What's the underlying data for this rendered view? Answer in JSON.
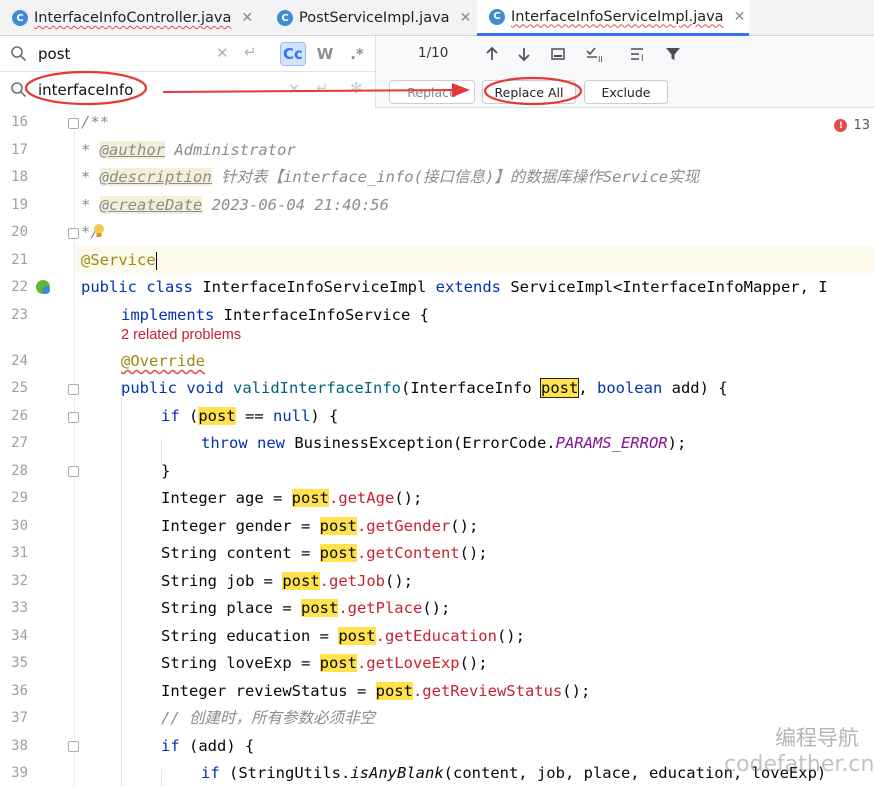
{
  "tabs": [
    {
      "label": "InterfaceInfoController.java",
      "icon": "C"
    },
    {
      "label": "PostServiceImpl.java",
      "icon": "C"
    },
    {
      "label": "InterfaceInfoServiceImpl.java",
      "icon": "C"
    }
  ],
  "find": {
    "search_value": "post",
    "replace_value": "interfaceInfo",
    "match_case_label": "Cc",
    "words_label": "W",
    "regex_label": ".*",
    "counter": "1/10"
  },
  "buttons": {
    "replace": "Replace",
    "replace_all": "Replace All",
    "exclude": "Exclude"
  },
  "editor": {
    "error_count": "13",
    "problems_hint": "2 related problems",
    "line_numbers": [
      "16",
      "17",
      "18",
      "19",
      "20",
      "21",
      "22",
      "23",
      "24",
      "25",
      "26",
      "27",
      "28",
      "29",
      "30",
      "31",
      "32",
      "33",
      "34",
      "35",
      "36",
      "37",
      "38",
      "39"
    ],
    "comment_open": "/**",
    "author_tag": "@author",
    "author_value": " Administrator",
    "desc_tag": "@description",
    "desc_value": " 针对表【interface_info(接口信息)】的数据库操作Service实现",
    "date_tag": "@createDate",
    "date_value": " 2023-06-04 21:40:56",
    "comment_star": "* ",
    "comment_close": "*/",
    "service_annotation": "@Service",
    "class_decl_public": "public",
    "class_decl_class": "class",
    "class_name": " InterfaceInfoServiceImpl ",
    "extends_kw": "extends",
    "extends_type": " ServiceImpl<InterfaceInfoMapper, I",
    "implements_kw": "implements",
    "implements_type": " InterfaceInfoService {",
    "override_annotation": "@Override",
    "public_kw": "public",
    "void_kw": "void",
    "method_name": "validInterfaceInfo",
    "param_type": "(InterfaceInfo ",
    "hit": "post",
    "param_rest_sep": ", ",
    "boolean_kw": "boolean",
    "param_rest": " add) {",
    "if_kw": "if",
    "if_open": " (",
    "if_rest": " == ",
    "null_kw": "null",
    "if_close": ") {",
    "throw_kw": "throw",
    "new_kw": "new",
    "throw_rest": " BusinessException(ErrorCode.",
    "params_error": "PARAMS_ERROR",
    "throw_close": ");",
    "close_brace": "}",
    "decls": [
      {
        "prefix": "Integer age = ",
        "call": ".getAge",
        "suffix": "();"
      },
      {
        "prefix": "Integer gender = ",
        "call": ".getGender",
        "suffix": "();"
      },
      {
        "prefix": "String content = ",
        "call": ".getContent",
        "suffix": "();"
      },
      {
        "prefix": "String job = ",
        "call": ".getJob",
        "suffix": "();"
      },
      {
        "prefix": "String place = ",
        "call": ".getPlace",
        "suffix": "();"
      },
      {
        "prefix": "String education = ",
        "call": ".getEducation",
        "suffix": "();"
      },
      {
        "prefix": "String loveExp = ",
        "call": ".getLoveExp",
        "suffix": "();"
      },
      {
        "prefix": "Integer reviewStatus = ",
        "call": ".getReviewStatus",
        "suffix": "();"
      }
    ],
    "comment_line": "// 创建时，所有参数必须非空",
    "if_add_rest": " (add) {",
    "stringutils_prefix": " (StringUtils.",
    "is_any_blank": "isAnyBlank",
    "stringutils_rest": "(content, job, place, education, loveExp)"
  },
  "watermark": {
    "line1": "编程导航",
    "line2": "codefather.cn"
  },
  "colors": {
    "accent": "#3574f0",
    "highlight": "#ffe24c",
    "annotation_red": "#e53935"
  }
}
